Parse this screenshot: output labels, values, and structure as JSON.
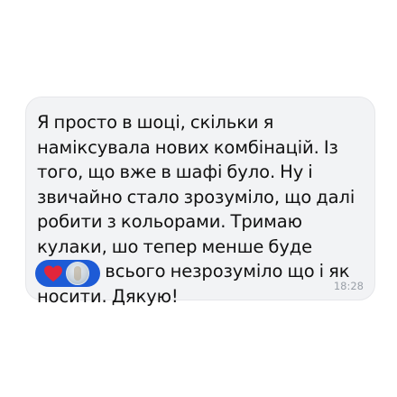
{
  "message": {
    "text": "Я просто в шоці, скільки я наміксувала нових комбінацій. Із того, що вже в шафі було. Ну і звичайно стало зрозуміло, що далі робити з кольорами. Тримаю кулаки, шо тепер менше буде оцього всього незрозуміло що і як носити. Дякую!",
    "time": "18:28"
  },
  "reaction": {
    "icon": "heart-icon",
    "color": "#1d5bd6",
    "heart_color": "#e2263b"
  }
}
